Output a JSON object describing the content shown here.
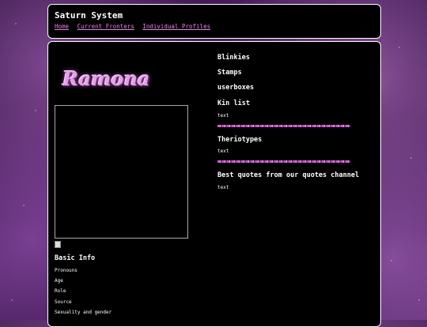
{
  "site": {
    "title": "Saturn System"
  },
  "nav": {
    "links": [
      "Home",
      "Current Fronters",
      "Individual Profiles"
    ]
  },
  "profile": {
    "logo_text": "Ramona"
  },
  "basic_info": {
    "heading": "Basic Info",
    "items": [
      "Pronouns",
      "Age",
      "Role",
      "Source",
      "Sexuality and gender"
    ]
  },
  "right": {
    "blinkies": "Blinkies",
    "stamps": "Stamps",
    "userboxes": "userboxes",
    "kin": {
      "heading": "Kin list",
      "text": "text"
    },
    "therio": {
      "heading": "Theriotypes",
      "text": "text"
    },
    "quotes": {
      "heading": "Best quotes from our quotes channel",
      "text": "text"
    }
  },
  "colors": {
    "link": "#e880e8",
    "panel": "#000000",
    "accent": "#c25bc4"
  }
}
